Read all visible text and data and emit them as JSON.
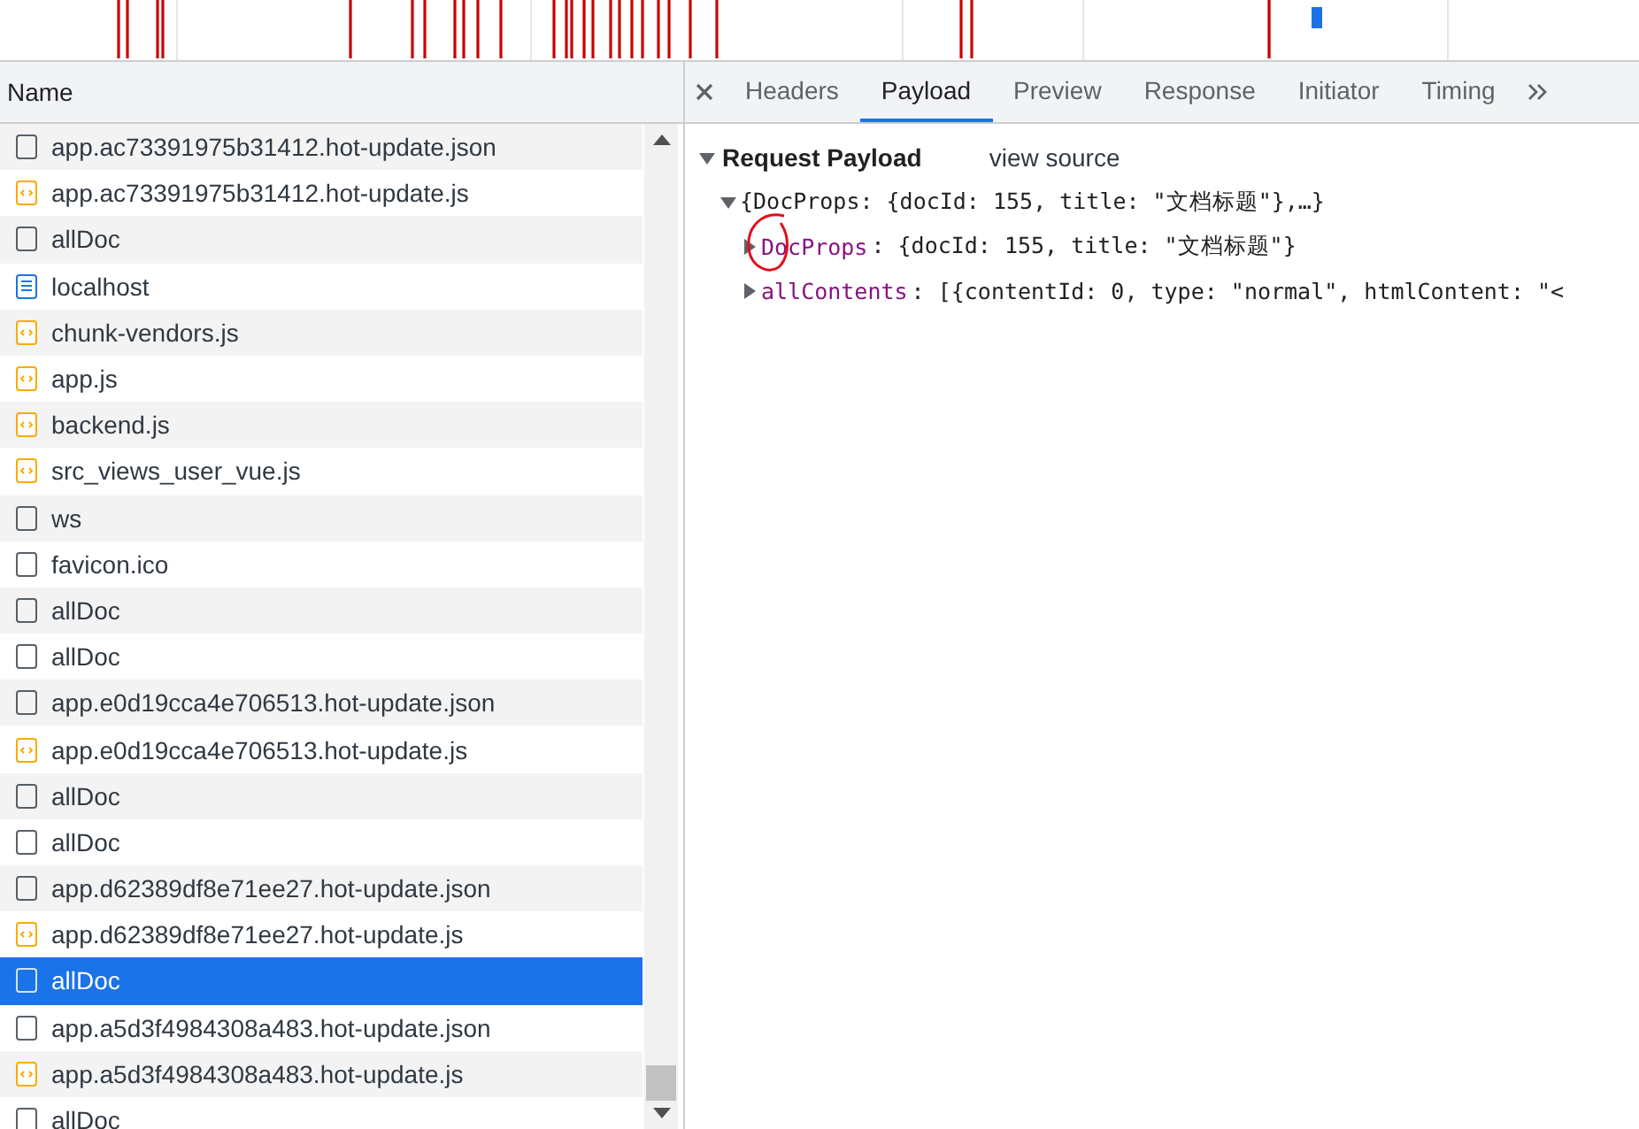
{
  "requests": {
    "column": "Name",
    "rows": [
      {
        "name": "app.ac73391975b31412.hot-update.json",
        "kind": "plain",
        "selected": false
      },
      {
        "name": "app.ac73391975b31412.hot-update.js",
        "kind": "script",
        "selected": false
      },
      {
        "name": "allDoc",
        "kind": "plain",
        "selected": false
      },
      {
        "name": "localhost",
        "kind": "document",
        "selected": false
      },
      {
        "name": "chunk-vendors.js",
        "kind": "script",
        "selected": false
      },
      {
        "name": "app.js",
        "kind": "script",
        "selected": false
      },
      {
        "name": "backend.js",
        "kind": "script",
        "selected": false
      },
      {
        "name": "src_views_user_vue.js",
        "kind": "script",
        "selected": false
      },
      {
        "name": "ws",
        "kind": "plain",
        "selected": false
      },
      {
        "name": "favicon.ico",
        "kind": "plain",
        "selected": false
      },
      {
        "name": "allDoc",
        "kind": "plain",
        "selected": false
      },
      {
        "name": "allDoc",
        "kind": "plain",
        "selected": false
      },
      {
        "name": "app.e0d19cca4e706513.hot-update.json",
        "kind": "plain",
        "selected": false
      },
      {
        "name": "app.e0d19cca4e706513.hot-update.js",
        "kind": "script",
        "selected": false
      },
      {
        "name": "allDoc",
        "kind": "plain",
        "selected": false
      },
      {
        "name": "allDoc",
        "kind": "plain",
        "selected": false
      },
      {
        "name": "app.d62389df8e71ee27.hot-update.json",
        "kind": "plain",
        "selected": false
      },
      {
        "name": "app.d62389df8e71ee27.hot-update.js",
        "kind": "script",
        "selected": false
      },
      {
        "name": "allDoc",
        "kind": "plain",
        "selected": true
      },
      {
        "name": "app.a5d3f4984308a483.hot-update.json",
        "kind": "plain",
        "selected": false
      },
      {
        "name": "app.a5d3f4984308a483.hot-update.js",
        "kind": "script",
        "selected": false
      },
      {
        "name": "allDoc",
        "kind": "plain",
        "selected": false
      }
    ]
  },
  "tabs": [
    {
      "label": "Headers",
      "selected": false
    },
    {
      "label": "Payload",
      "selected": true
    },
    {
      "label": "Preview",
      "selected": false
    },
    {
      "label": "Response",
      "selected": false
    },
    {
      "label": "Initiator",
      "selected": false
    },
    {
      "label": "Timing",
      "selected": false
    }
  ],
  "payload": {
    "title": "Request Payload",
    "expanded": true,
    "view_source": "view source",
    "root": {
      "text": "{DocProps: {docId: 155, title: \"文档标题\"},…}",
      "expanded": true,
      "children": [
        {
          "key": "DocProps",
          "value": ": {docId: 155, title: \"文档标题\"}",
          "expanded": false,
          "circled": true
        },
        {
          "key": "allContents",
          "value": ": [{contentId: 0, type: \"normal\", htmlContent: \"<",
          "expanded": false,
          "circled": false
        }
      ]
    }
  }
}
